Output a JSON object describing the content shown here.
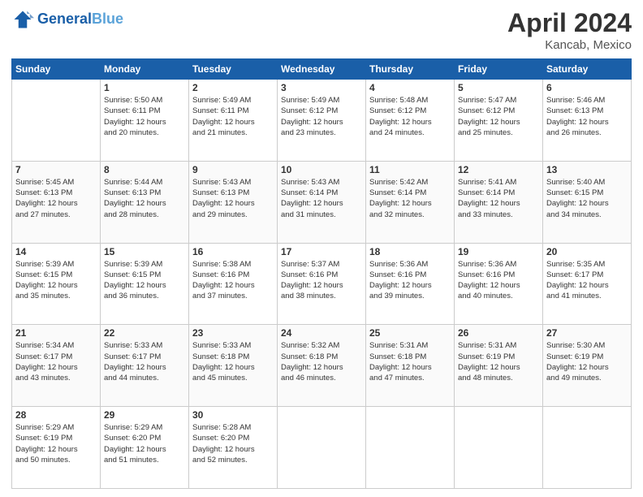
{
  "header": {
    "logo_general": "General",
    "logo_blue": "Blue",
    "title": "April 2024",
    "subtitle": "Kancab, Mexico"
  },
  "days_of_week": [
    "Sunday",
    "Monday",
    "Tuesday",
    "Wednesday",
    "Thursday",
    "Friday",
    "Saturday"
  ],
  "weeks": [
    [
      {
        "day": "",
        "sunrise": "",
        "sunset": "",
        "daylight": ""
      },
      {
        "day": "1",
        "sunrise": "Sunrise: 5:50 AM",
        "sunset": "Sunset: 6:11 PM",
        "daylight": "Daylight: 12 hours and 20 minutes."
      },
      {
        "day": "2",
        "sunrise": "Sunrise: 5:49 AM",
        "sunset": "Sunset: 6:11 PM",
        "daylight": "Daylight: 12 hours and 21 minutes."
      },
      {
        "day": "3",
        "sunrise": "Sunrise: 5:49 AM",
        "sunset": "Sunset: 6:12 PM",
        "daylight": "Daylight: 12 hours and 23 minutes."
      },
      {
        "day": "4",
        "sunrise": "Sunrise: 5:48 AM",
        "sunset": "Sunset: 6:12 PM",
        "daylight": "Daylight: 12 hours and 24 minutes."
      },
      {
        "day": "5",
        "sunrise": "Sunrise: 5:47 AM",
        "sunset": "Sunset: 6:12 PM",
        "daylight": "Daylight: 12 hours and 25 minutes."
      },
      {
        "day": "6",
        "sunrise": "Sunrise: 5:46 AM",
        "sunset": "Sunset: 6:13 PM",
        "daylight": "Daylight: 12 hours and 26 minutes."
      }
    ],
    [
      {
        "day": "7",
        "sunrise": "Sunrise: 5:45 AM",
        "sunset": "Sunset: 6:13 PM",
        "daylight": "Daylight: 12 hours and 27 minutes."
      },
      {
        "day": "8",
        "sunrise": "Sunrise: 5:44 AM",
        "sunset": "Sunset: 6:13 PM",
        "daylight": "Daylight: 12 hours and 28 minutes."
      },
      {
        "day": "9",
        "sunrise": "Sunrise: 5:43 AM",
        "sunset": "Sunset: 6:13 PM",
        "daylight": "Daylight: 12 hours and 29 minutes."
      },
      {
        "day": "10",
        "sunrise": "Sunrise: 5:43 AM",
        "sunset": "Sunset: 6:14 PM",
        "daylight": "Daylight: 12 hours and 31 minutes."
      },
      {
        "day": "11",
        "sunrise": "Sunrise: 5:42 AM",
        "sunset": "Sunset: 6:14 PM",
        "daylight": "Daylight: 12 hours and 32 minutes."
      },
      {
        "day": "12",
        "sunrise": "Sunrise: 5:41 AM",
        "sunset": "Sunset: 6:14 PM",
        "daylight": "Daylight: 12 hours and 33 minutes."
      },
      {
        "day": "13",
        "sunrise": "Sunrise: 5:40 AM",
        "sunset": "Sunset: 6:15 PM",
        "daylight": "Daylight: 12 hours and 34 minutes."
      }
    ],
    [
      {
        "day": "14",
        "sunrise": "Sunrise: 5:39 AM",
        "sunset": "Sunset: 6:15 PM",
        "daylight": "Daylight: 12 hours and 35 minutes."
      },
      {
        "day": "15",
        "sunrise": "Sunrise: 5:39 AM",
        "sunset": "Sunset: 6:15 PM",
        "daylight": "Daylight: 12 hours and 36 minutes."
      },
      {
        "day": "16",
        "sunrise": "Sunrise: 5:38 AM",
        "sunset": "Sunset: 6:16 PM",
        "daylight": "Daylight: 12 hours and 37 minutes."
      },
      {
        "day": "17",
        "sunrise": "Sunrise: 5:37 AM",
        "sunset": "Sunset: 6:16 PM",
        "daylight": "Daylight: 12 hours and 38 minutes."
      },
      {
        "day": "18",
        "sunrise": "Sunrise: 5:36 AM",
        "sunset": "Sunset: 6:16 PM",
        "daylight": "Daylight: 12 hours and 39 minutes."
      },
      {
        "day": "19",
        "sunrise": "Sunrise: 5:36 AM",
        "sunset": "Sunset: 6:16 PM",
        "daylight": "Daylight: 12 hours and 40 minutes."
      },
      {
        "day": "20",
        "sunrise": "Sunrise: 5:35 AM",
        "sunset": "Sunset: 6:17 PM",
        "daylight": "Daylight: 12 hours and 41 minutes."
      }
    ],
    [
      {
        "day": "21",
        "sunrise": "Sunrise: 5:34 AM",
        "sunset": "Sunset: 6:17 PM",
        "daylight": "Daylight: 12 hours and 43 minutes."
      },
      {
        "day": "22",
        "sunrise": "Sunrise: 5:33 AM",
        "sunset": "Sunset: 6:17 PM",
        "daylight": "Daylight: 12 hours and 44 minutes."
      },
      {
        "day": "23",
        "sunrise": "Sunrise: 5:33 AM",
        "sunset": "Sunset: 6:18 PM",
        "daylight": "Daylight: 12 hours and 45 minutes."
      },
      {
        "day": "24",
        "sunrise": "Sunrise: 5:32 AM",
        "sunset": "Sunset: 6:18 PM",
        "daylight": "Daylight: 12 hours and 46 minutes."
      },
      {
        "day": "25",
        "sunrise": "Sunrise: 5:31 AM",
        "sunset": "Sunset: 6:18 PM",
        "daylight": "Daylight: 12 hours and 47 minutes."
      },
      {
        "day": "26",
        "sunrise": "Sunrise: 5:31 AM",
        "sunset": "Sunset: 6:19 PM",
        "daylight": "Daylight: 12 hours and 48 minutes."
      },
      {
        "day": "27",
        "sunrise": "Sunrise: 5:30 AM",
        "sunset": "Sunset: 6:19 PM",
        "daylight": "Daylight: 12 hours and 49 minutes."
      }
    ],
    [
      {
        "day": "28",
        "sunrise": "Sunrise: 5:29 AM",
        "sunset": "Sunset: 6:19 PM",
        "daylight": "Daylight: 12 hours and 50 minutes."
      },
      {
        "day": "29",
        "sunrise": "Sunrise: 5:29 AM",
        "sunset": "Sunset: 6:20 PM",
        "daylight": "Daylight: 12 hours and 51 minutes."
      },
      {
        "day": "30",
        "sunrise": "Sunrise: 5:28 AM",
        "sunset": "Sunset: 6:20 PM",
        "daylight": "Daylight: 12 hours and 52 minutes."
      },
      {
        "day": "",
        "sunrise": "",
        "sunset": "",
        "daylight": ""
      },
      {
        "day": "",
        "sunrise": "",
        "sunset": "",
        "daylight": ""
      },
      {
        "day": "",
        "sunrise": "",
        "sunset": "",
        "daylight": ""
      },
      {
        "day": "",
        "sunrise": "",
        "sunset": "",
        "daylight": ""
      }
    ]
  ]
}
